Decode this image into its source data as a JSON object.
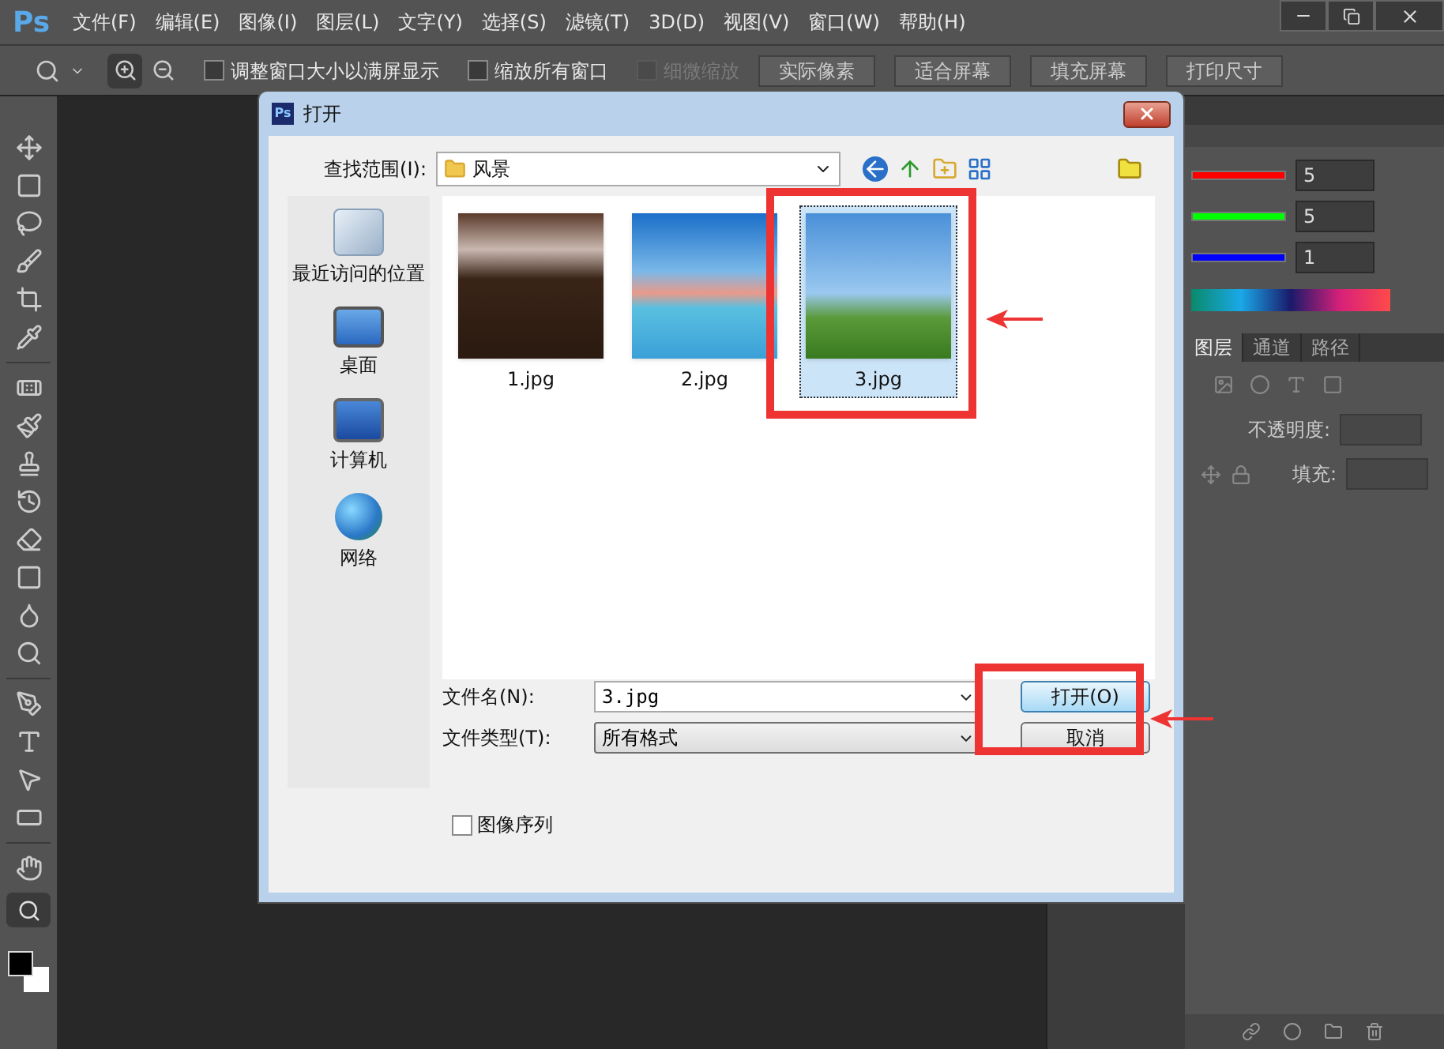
{
  "app": {
    "logo": "Ps"
  },
  "menu": [
    "文件(F)",
    "编辑(E)",
    "图像(I)",
    "图层(L)",
    "文字(Y)",
    "选择(S)",
    "滤镜(T)",
    "3D(D)",
    "视图(V)",
    "窗口(W)",
    "帮助(H)"
  ],
  "options_bar": {
    "checkboxes": [
      {
        "label": "调整窗口大小以满屏显示",
        "checked": false,
        "disabled": false
      },
      {
        "label": "缩放所有窗口",
        "checked": false,
        "disabled": false
      },
      {
        "label": "细微缩放",
        "checked": false,
        "disabled": true
      }
    ],
    "buttons": [
      "实际像素",
      "适合屏幕",
      "填充屏幕",
      "打印尺寸"
    ]
  },
  "color_panel": {
    "channels": [
      {
        "value": "5",
        "color": "#ff0000"
      },
      {
        "value": "5",
        "color": "#00ff00"
      },
      {
        "value": "1",
        "color": "#0000ff"
      }
    ]
  },
  "layers_panel": {
    "tabs": [
      {
        "label": "图层",
        "selected": true
      },
      {
        "label": "通道",
        "selected": false
      },
      {
        "label": "路径",
        "selected": false
      }
    ],
    "opacity_label": "不透明度:",
    "fill_label": "填充:"
  },
  "dialog": {
    "logo": "Ps",
    "title": "打开",
    "look_in_label": "查找范围(I):",
    "folder": "风景",
    "places": [
      {
        "label": "最近访问的位置",
        "kind": "recent"
      },
      {
        "label": "桌面",
        "kind": "desktop"
      },
      {
        "label": "计算机",
        "kind": "computer"
      },
      {
        "label": "网络",
        "kind": "network"
      }
    ],
    "files": [
      {
        "name": "1.jpg",
        "selected": false,
        "kind": "night"
      },
      {
        "name": "2.jpg",
        "selected": false,
        "kind": "sea"
      },
      {
        "name": "3.jpg",
        "selected": true,
        "kind": "flower"
      }
    ],
    "filename_label": "文件名(N):",
    "filename": "3.jpg",
    "filetype_label": "文件类型(T):",
    "filetype": "所有格式",
    "buttons": [
      "打开(O)",
      "取消"
    ],
    "sequence_checkbox": {
      "label": "图像序列",
      "checked": false
    }
  }
}
